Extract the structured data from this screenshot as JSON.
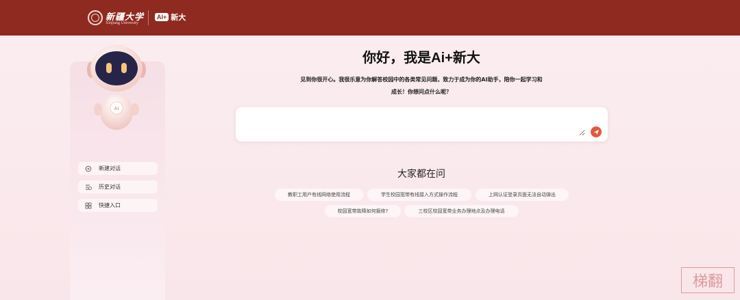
{
  "header": {
    "university_name_cn": "新疆大学",
    "university_name_en": "Xinjiang University",
    "ai_mark": "AI+",
    "ai_label": "新大",
    "bg_color": "#8f2a20"
  },
  "sidebar": {
    "robot_badge": "AI",
    "items": [
      {
        "label": "新建对话",
        "icon": "new-chat-icon"
      },
      {
        "label": "历史对话",
        "icon": "history-icon"
      },
      {
        "label": "快捷入口",
        "icon": "grid-icon"
      }
    ]
  },
  "main": {
    "title": "你好，我是Ai+新大",
    "intro_line1": "见到你很开心。我很乐意为你解答校园中的各类常见问题，致力于成为你的AI助手，陪你一起学习和",
    "intro_line2": "成长！你想问点什么呢？",
    "input_value": "",
    "input_placeholder": "",
    "send_icon": "send-icon",
    "accent_color": "#e25a3a"
  },
  "popular": {
    "title": "大家都在问",
    "questions": [
      "教职工用户有线网络使用流程",
      "学生校园宽带有线接入方式操作流程",
      "上网认证登录页面无法自动弹出",
      "校园宽带故障如何报修?",
      "三校区校园宽带业务办理地点及办理电话"
    ]
  },
  "watermark": {
    "text": "梯翻"
  }
}
